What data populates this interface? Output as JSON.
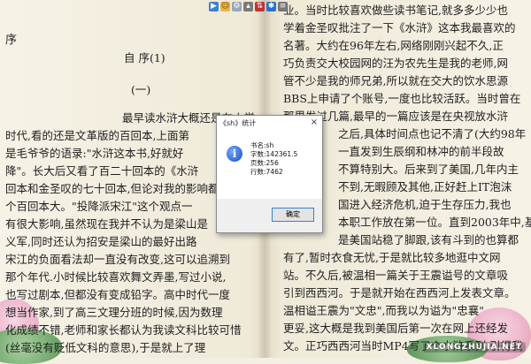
{
  "left_page": {
    "heading": "序",
    "title": "自 序(1)",
    "subtitle": "(一)",
    "lines": [
      "最早读水浒大概还是在小学",
      "时代,看的还是文革版的百回本,上面第",
      "是毛爷爷的语录:\"水浒这本书,好就好",
      "降\"。长大后又看了百二十回本的《水浒",
      "回本和金圣叹的七十回本,但论对我的影响都",
      "个百回本大。\"投降派宋江\"这个观点一",
      "有很大影响,虽然现在我并不认为是梁山是",
      "义军,同时还认为招安是梁山的最好出路",
      "宋江的负面看法却一直没有改变,这可以追溯到",
      "那个年代.小时候比较喜欢舞文弄墨,写过小说,",
      "也写过剧本,但都没有变成铅字。高中时代一度",
      "想当作家,到了高三文理分班的时候,因为数理",
      "化成绩不错,老师和家长都认为我读文科比较可惜",
      "(丝毫没有贬低文科的意思),于是就上了理",
      "科班,进了个纯工科的上海交大学了计算机专"
    ]
  },
  "right_page": {
    "lines": [
      "业。当时比较喜欢做些读书笔记,就多多少少也",
      "学着金圣叹批注了一下《水浒》这本我最喜欢的",
      "名著。大约在96年左右,网络刚刚兴起不久,正",
      "巧负责交大校园网的汪为农先生是我的老师,网",
      "管不少是我的师兄弟,所以就在交大的饮水思源",
      "BBS上申请了个账号,一度也比较活跃。当时曾在",
      "那里发过几篇,最早的一篇应该是在央视放水浒",
      "之后,具体时间点也记不清了(大约98年",
      "一直发到生辰纲和林冲的前半段故",
      "不算特别大。后来到了美国,几年内主",
      "不到,无暇顾及其他,正好赶上IT泡沫",
      "国进入经济危机,迫于生存压力,我也",
      "本职工作放在第一位。直到2003年中,基",
      "是美国站稳了脚跟,该有斗到的也算都",
      "有了,暂时衣食无忧,于是就比较多地逛中文网",
      "站。不久后,被温相一篇关于王震谥号的文章吸",
      "引到西西河。于是就开始在西西河上发表文章。",
      "温相谥王震为\"文忠\",而我以为谥为\"忠襄\"",
      "更妥,这大概是我到美国后第一次在网上还经发",
      "文。正巧西西河当时MP4写了个水浒系列,引得我",
      "手痒,就把当年的笔记找出来,重新整理一下,"
    ]
  },
  "dialog": {
    "title": "《sh》统计",
    "close": "×",
    "stats": [
      {
        "label": "书名:",
        "value": "sh"
      },
      {
        "label": "字数:",
        "value": "142361.5"
      },
      {
        "label": "页数:",
        "value": "256"
      },
      {
        "label": "行数:",
        "value": "7462"
      }
    ],
    "ok_label": "确定"
  },
  "toolbar": {
    "icons": [
      "play-icon",
      "face-icon",
      "gear-icon",
      "tag-icon",
      "arrow-up-down-icon",
      "star-icon",
      "more-icon"
    ]
  },
  "watermark": "XLONGZHUJIA.NET"
}
